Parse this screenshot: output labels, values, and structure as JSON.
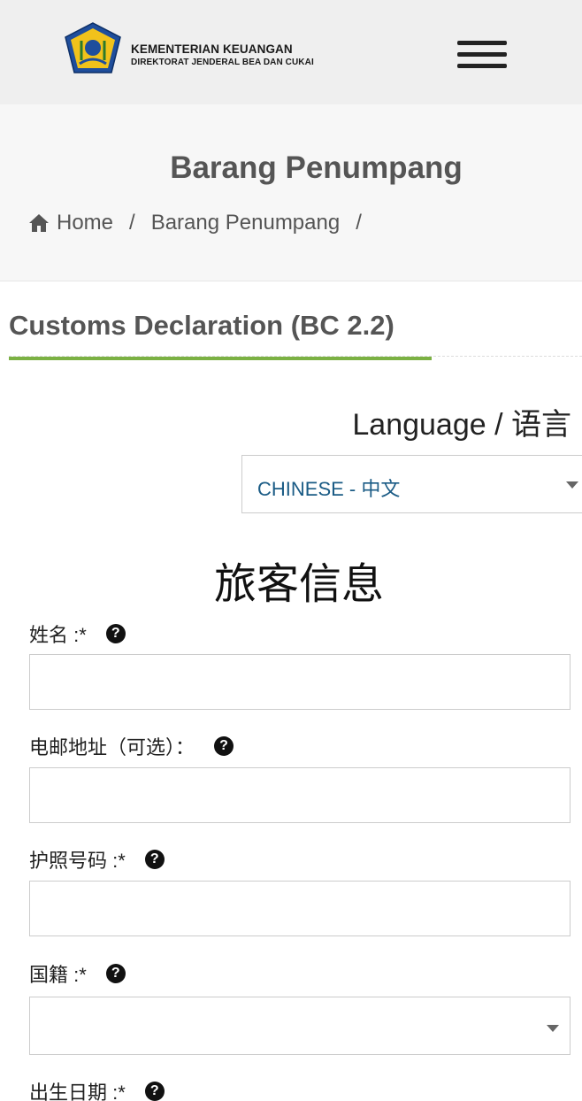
{
  "header": {
    "org_line1": "KEMENTERIAN KEUANGAN",
    "org_line2": "DIREKTORAT JENDERAL BEA DAN CUKAI",
    "logo_icon": "ministry-emblem-icon",
    "menu_icon": "hamburger-menu-icon"
  },
  "hero": {
    "title": "Barang Penumpang",
    "breadcrumb": {
      "home": "Home",
      "current": "Barang Penumpang",
      "separator": "/"
    }
  },
  "section": {
    "title": "Customs Declaration (BC 2.2)",
    "accent_color": "#7bb143"
  },
  "language": {
    "label": "Language / 语言",
    "selected": "CHINESE - 中文"
  },
  "form": {
    "heading": "旅客信息",
    "help_glyph": "?",
    "fields": [
      {
        "label": "姓名 :*",
        "value": "",
        "type": "text"
      },
      {
        "label": "电邮地址（可选）：",
        "value": "",
        "type": "text"
      },
      {
        "label": "护照号码 :*",
        "value": "",
        "type": "text"
      },
      {
        "label": "国籍 :*",
        "value": "",
        "type": "select"
      },
      {
        "label": "出生日期 :*",
        "value": "",
        "type": "date"
      }
    ]
  }
}
